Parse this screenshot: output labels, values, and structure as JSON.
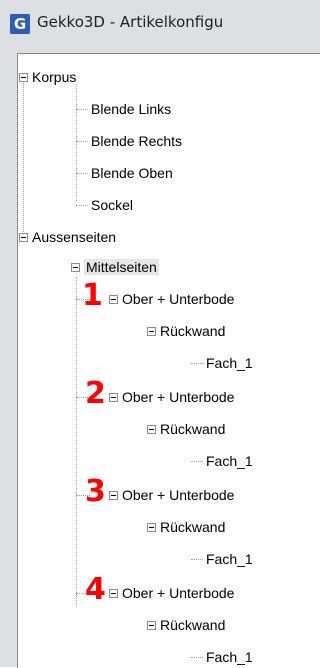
{
  "window": {
    "title": "Gekko3D - Artikelkonfigu",
    "logo_letter": "G"
  },
  "tree": {
    "korpus": {
      "label": "Korpus",
      "children": [
        "Blende Links",
        "Blende Rechts",
        "Blende Oben",
        "Sockel"
      ]
    },
    "aussenseiten": {
      "label": "Aussenseiten",
      "mittelseiten": {
        "label": "Mittelseiten",
        "groups": [
          {
            "label": "Ober + Unterbode",
            "child": "Rückwand",
            "leaf": "Fach_1"
          },
          {
            "label": "Ober + Unterbode",
            "child": "Rückwand",
            "leaf": "Fach_1"
          },
          {
            "label": "Ober + Unterbode",
            "child": "Rückwand",
            "leaf": "Fach_1"
          },
          {
            "label": "Ober + Unterbode",
            "child": "Rückwand",
            "leaf": "Fach_1"
          }
        ]
      }
    }
  },
  "annotations": [
    "1",
    "2",
    "3",
    "4"
  ],
  "colors": {
    "annotation": "#ff0000",
    "logo": "#2f5db4",
    "selection": "#e6e6e6"
  }
}
